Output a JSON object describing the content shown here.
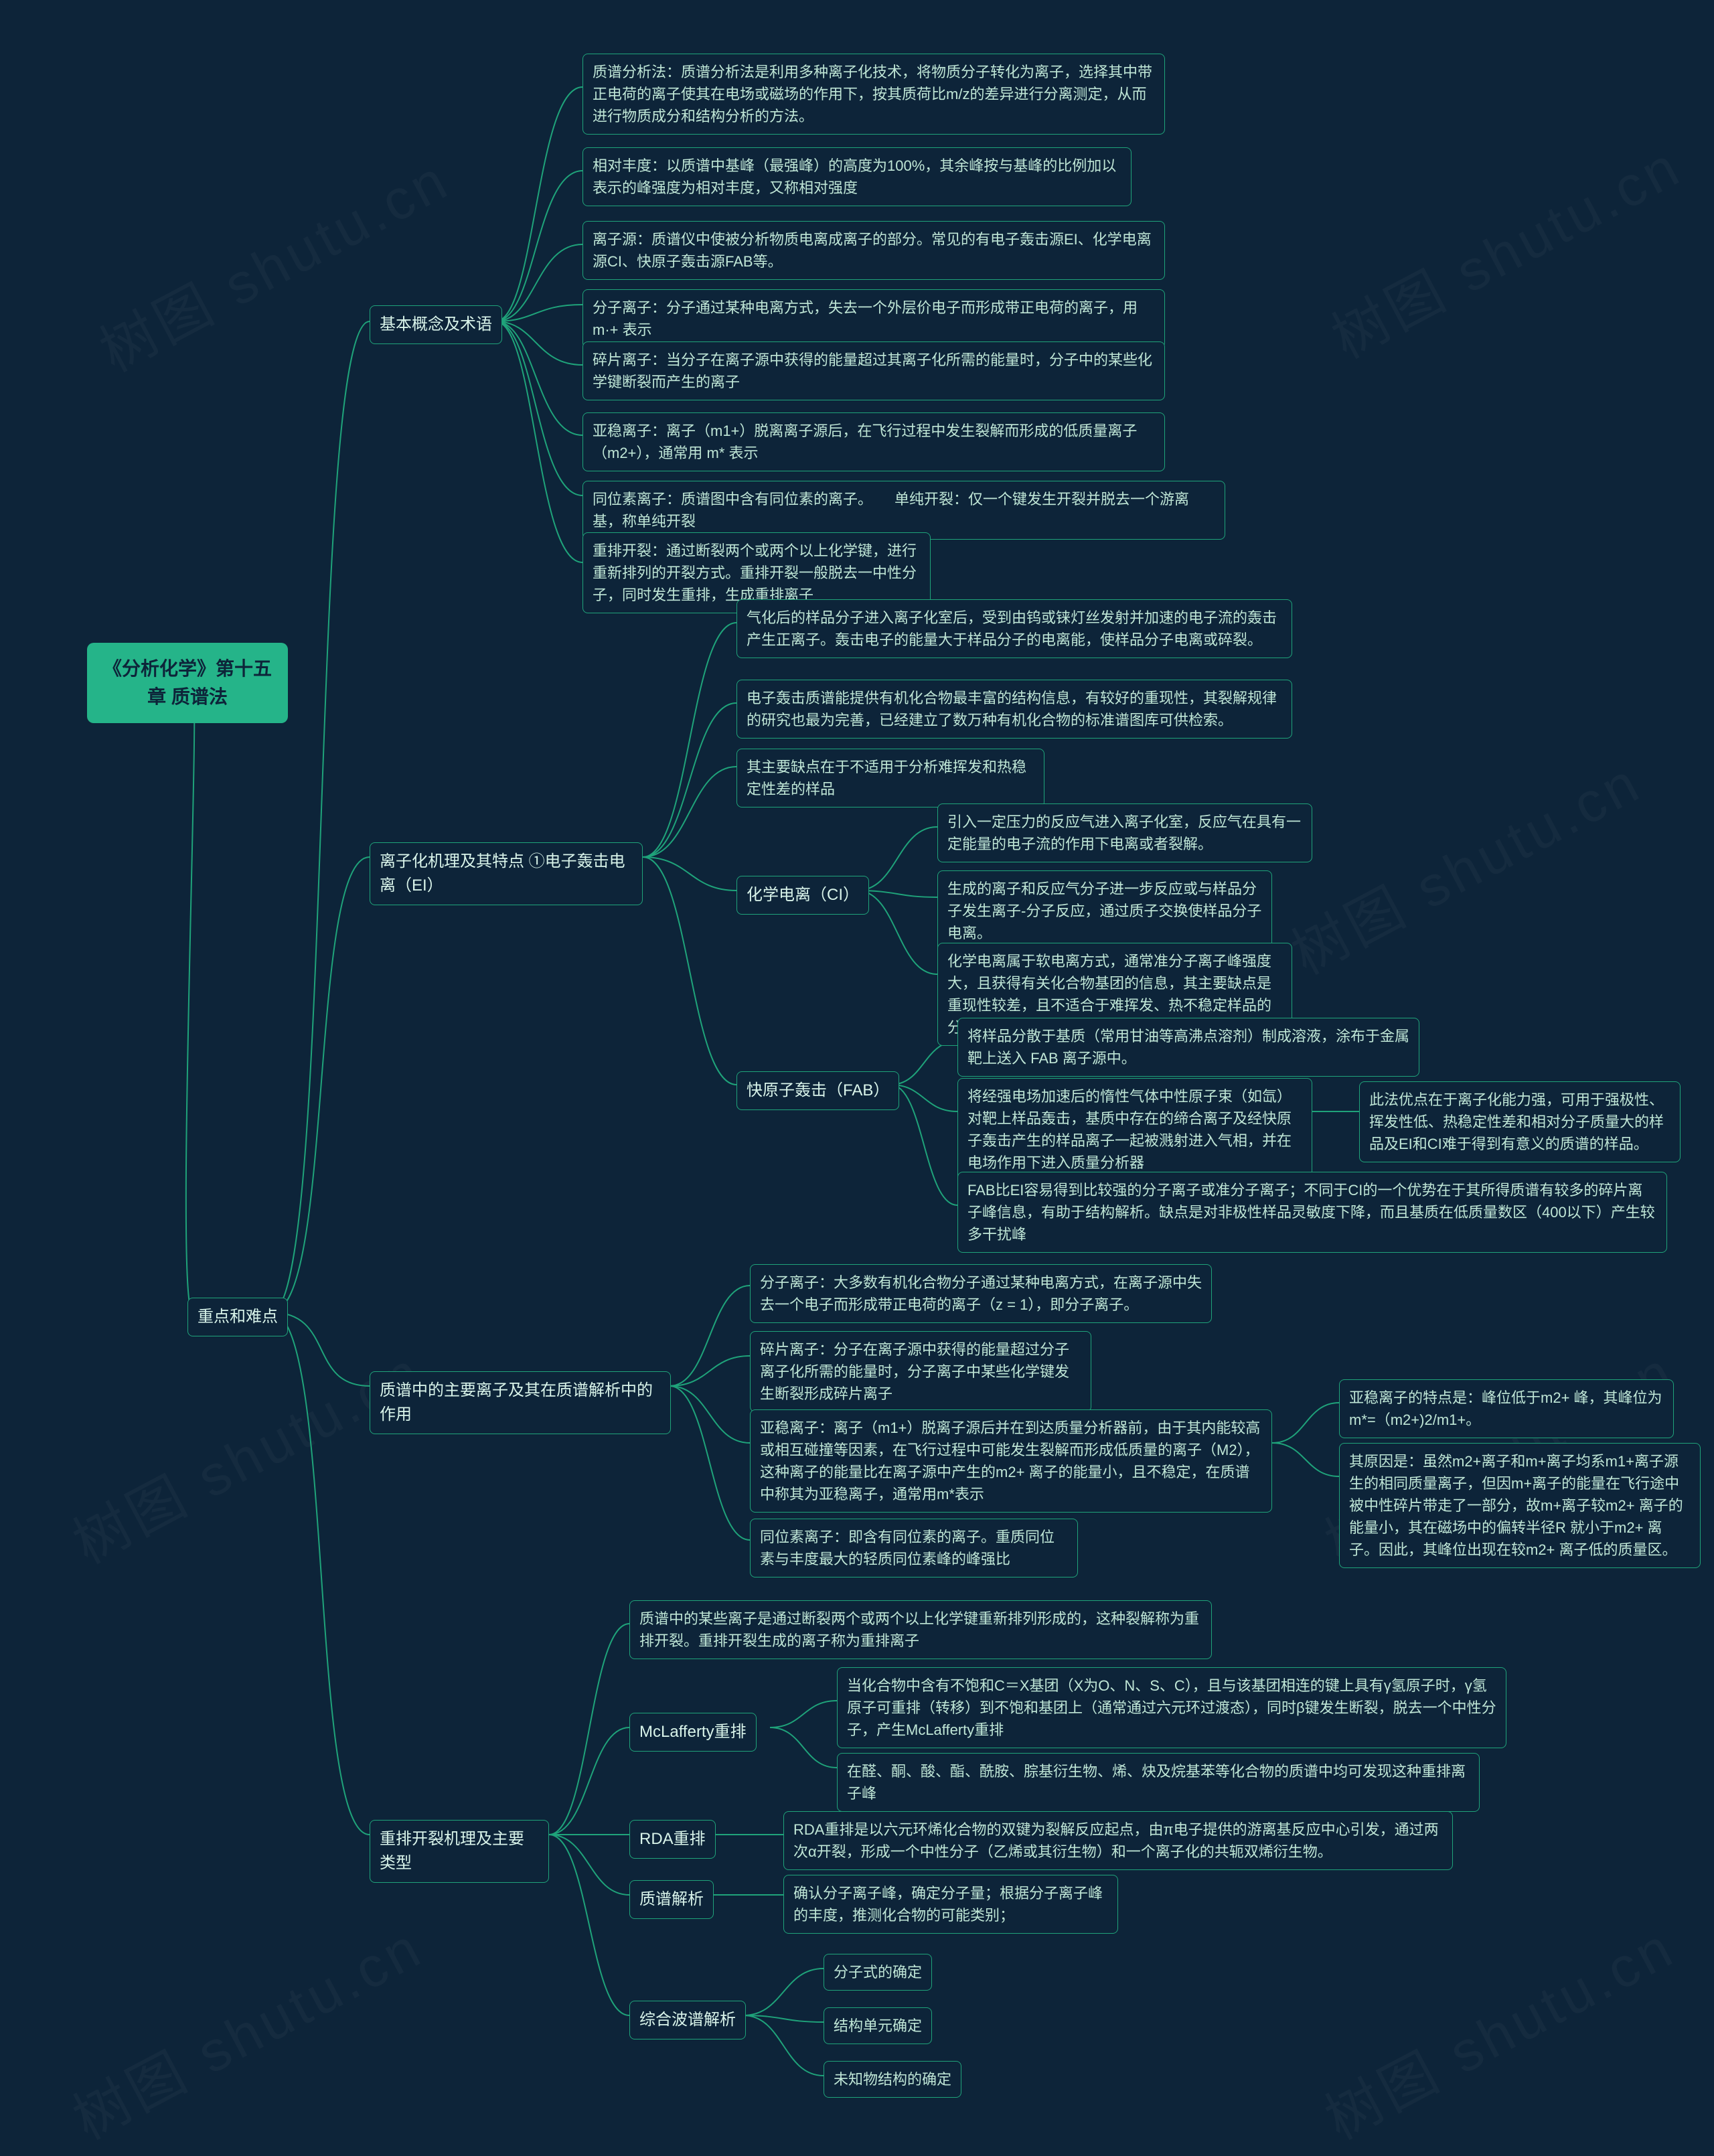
{
  "watermark": {
    "text": "树图 shutu.cn"
  },
  "root": {
    "title": "《分析化学》第十五章 质谱法"
  },
  "L1": {
    "zhongdian": "重点和难点"
  },
  "L2": {
    "sec1": "基本概念及术语",
    "sec2": "离子化机理及其特点 ①电子轰击电离（EI）",
    "sec3": "质谱中的主要离子及其在质谱解析中的作用",
    "sec4": "重排开裂机理及主要类型"
  },
  "sec1": {
    "n1": "质谱分析法：质谱分析法是利用多种离子化技术，将物质分子转化为离子，选择其中带正电荷的离子使其在电场或磁场的作用下，按其质荷比m/z的差异进行分离测定，从而进行物质成分和结构分析的方法。",
    "n2": "相对丰度：以质谱中基峰（最强峰）的高度为100%，其余峰按与基峰的比例加以表示的峰强度为相对丰度，又称相对强度",
    "n3": "离子源：质谱仪中使被分析物质电离成离子的部分。常见的有电子轰击源EI、化学电离源CI、快原子轰击源FAB等。",
    "n4": "分子离子：分子通过某种电离方式，失去一个外层价电子而形成带正电荷的离子，用m·+ 表示",
    "n5": "碎片离子：当分子在离子源中获得的能量超过其离子化所需的能量时，分子中的某些化学键断裂而产生的离子",
    "n6": "亚稳离子：离子（m1+）脱离离子源后，在飞行过程中发生裂解而形成的低质量离子（m2+），通常用 m* 表示",
    "n7": "同位素离子：质谱图中含有同位素的离子。　　单纯开裂：仅一个键发生开裂并脱去一个游离基，称单纯开裂",
    "n8": "重排开裂：通过断裂两个或两个以上化学键，进行重新排列的开裂方式。重排开裂一般脱去一中性分子，同时发生重排，生成重排离子"
  },
  "sec2": {
    "n1": "气化后的样品分子进入离子化室后，受到由钨或铼灯丝发射并加速的电子流的轰击产生正离子。轰击电子的能量大于样品分子的电离能，使样品分子电离或碎裂。",
    "n2": "电子轰击质谱能提供有机化合物最丰富的结构信息，有较好的重现性，其裂解规律的研究也最为完善，已经建立了数万种有机化合物的标准谱图库可供检索。",
    "n3": "其主要缺点在于不适用于分析难挥发和热稳定性差的样品",
    "ci_label": "化学电离（CI）",
    "ci_n1": "引入一定压力的反应气进入离子化室，反应气在具有一定能量的电子流的作用下电离或者裂解。",
    "ci_n2": "生成的离子和反应气分子进一步反应或与样品分子发生离子-分子反应，通过质子交换使样品分子电离。",
    "ci_n3": "化学电离属于软电离方式，通常准分子离子峰强度大，且获得有关化合物基团的信息，其主要缺点是重现性较差，且不适合于难挥发、热不稳定样品的分析",
    "fab_label": "快原子轰击（FAB）",
    "fab_n1": "将样品分散于基质（常用甘油等高沸点溶剂）制成溶液，涂布于金属靶上送入 FAB 离子源中。",
    "fab_n2": "将经强电场加速后的惰性气体中性原子束（如氙）对靶上样品轰击，基质中存在的缔合离子及经快原子轰击产生的样品离子一起被溅射进入气相，并在电场作用下进入质量分析器",
    "fab_n2_side": "此法优点在于离子化能力强，可用于强极性、挥发性低、热稳定性差和相对分子质量大的样品及EI和CI难于得到有意义的质谱的样品。",
    "fab_n3": "FAB比EI容易得到比较强的分子离子或准分子离子；不同于CI的一个优势在于其所得质谱有较多的碎片离子峰信息，有助于结构解析。缺点是对非极性样品灵敏度下降，而且基质在低质量数区（400以下）产生较多干扰峰"
  },
  "sec3": {
    "n1": "分子离子：大多数有机化合物分子通过某种电离方式，在离子源中失去一个电子而形成带正电荷的离子（z = 1），即分子离子。",
    "n2": "碎片离子：分子在离子源中获得的能量超过分子离子化所需的能量时，分子离子中某些化学键发生断裂形成碎片离子",
    "n3": "亚稳离子：离子（m1+）脱离子源后并在到达质量分析器前，由于其内能较高或相互碰撞等因素，在飞行过程中可能发生裂解而形成低质量的离子（M2），这种离子的能量比在离子源中产生的m2+ 离子的能量小，且不稳定，在质谱中称其为亚稳离子，通常用m*表示",
    "n3_side1": "亚稳离子的特点是：峰位低于m2+ 峰，其峰位为m*=（m2+)2/m1+。",
    "n3_side2": "其原因是：虽然m2+离子和m+离子均系m1+离子源生的相同质量离子，但因m+离子的能量在飞行途中被中性碎片带走了一部分，故m+离子较m2+ 离子的能量小，其在磁场中的偏转半径R 就小于m2+ 离子。因此，其峰位出现在较m2+ 离子低的质量区。",
    "n4": "同位素离子：即含有同位素的离子。重质同位素与丰度最大的轻质同位素峰的峰强比"
  },
  "sec4": {
    "n1": "质谱中的某些离子是通过断裂两个或两个以上化学键重新排列形成的，这种裂解称为重排开裂。重排开裂生成的离子称为重排离子",
    "mcl_label": "McLafferty重排",
    "mcl_n1": "当化合物中含有不饱和C＝X基团（X为O、N、S、C），且与该基团相连的键上具有γ氢原子时，γ氢原子可重排（转移）到不饱和基团上（通常通过六元环过渡态），同时β键发生断裂，脱去一个中性分子，产生McLafferty重排",
    "mcl_n2": "在醛、酮、酸、酯、酰胺、腙基衍生物、烯、炔及烷基苯等化合物的质谱中均可发现这种重排离子峰",
    "rda_label": "RDA重排",
    "rda_n1": "RDA重排是以六元环烯化合物的双键为裂解反应起点，由π电子提供的游离基反应中心引发，通过两次α开裂，形成一个中性分子（乙烯或其衍生物）和一个离子化的共轭双烯衍生物。",
    "jp_label": "质谱解析",
    "jp_n1": "确认分子离子峰，确定分子量；根据分子离子峰的丰度，推测化合物的可能类别；",
    "zh_label": "综合波谱解析",
    "zh_n1": "分子式的确定",
    "zh_n2": "结构单元确定",
    "zh_n3": "未知物结构的确定"
  }
}
